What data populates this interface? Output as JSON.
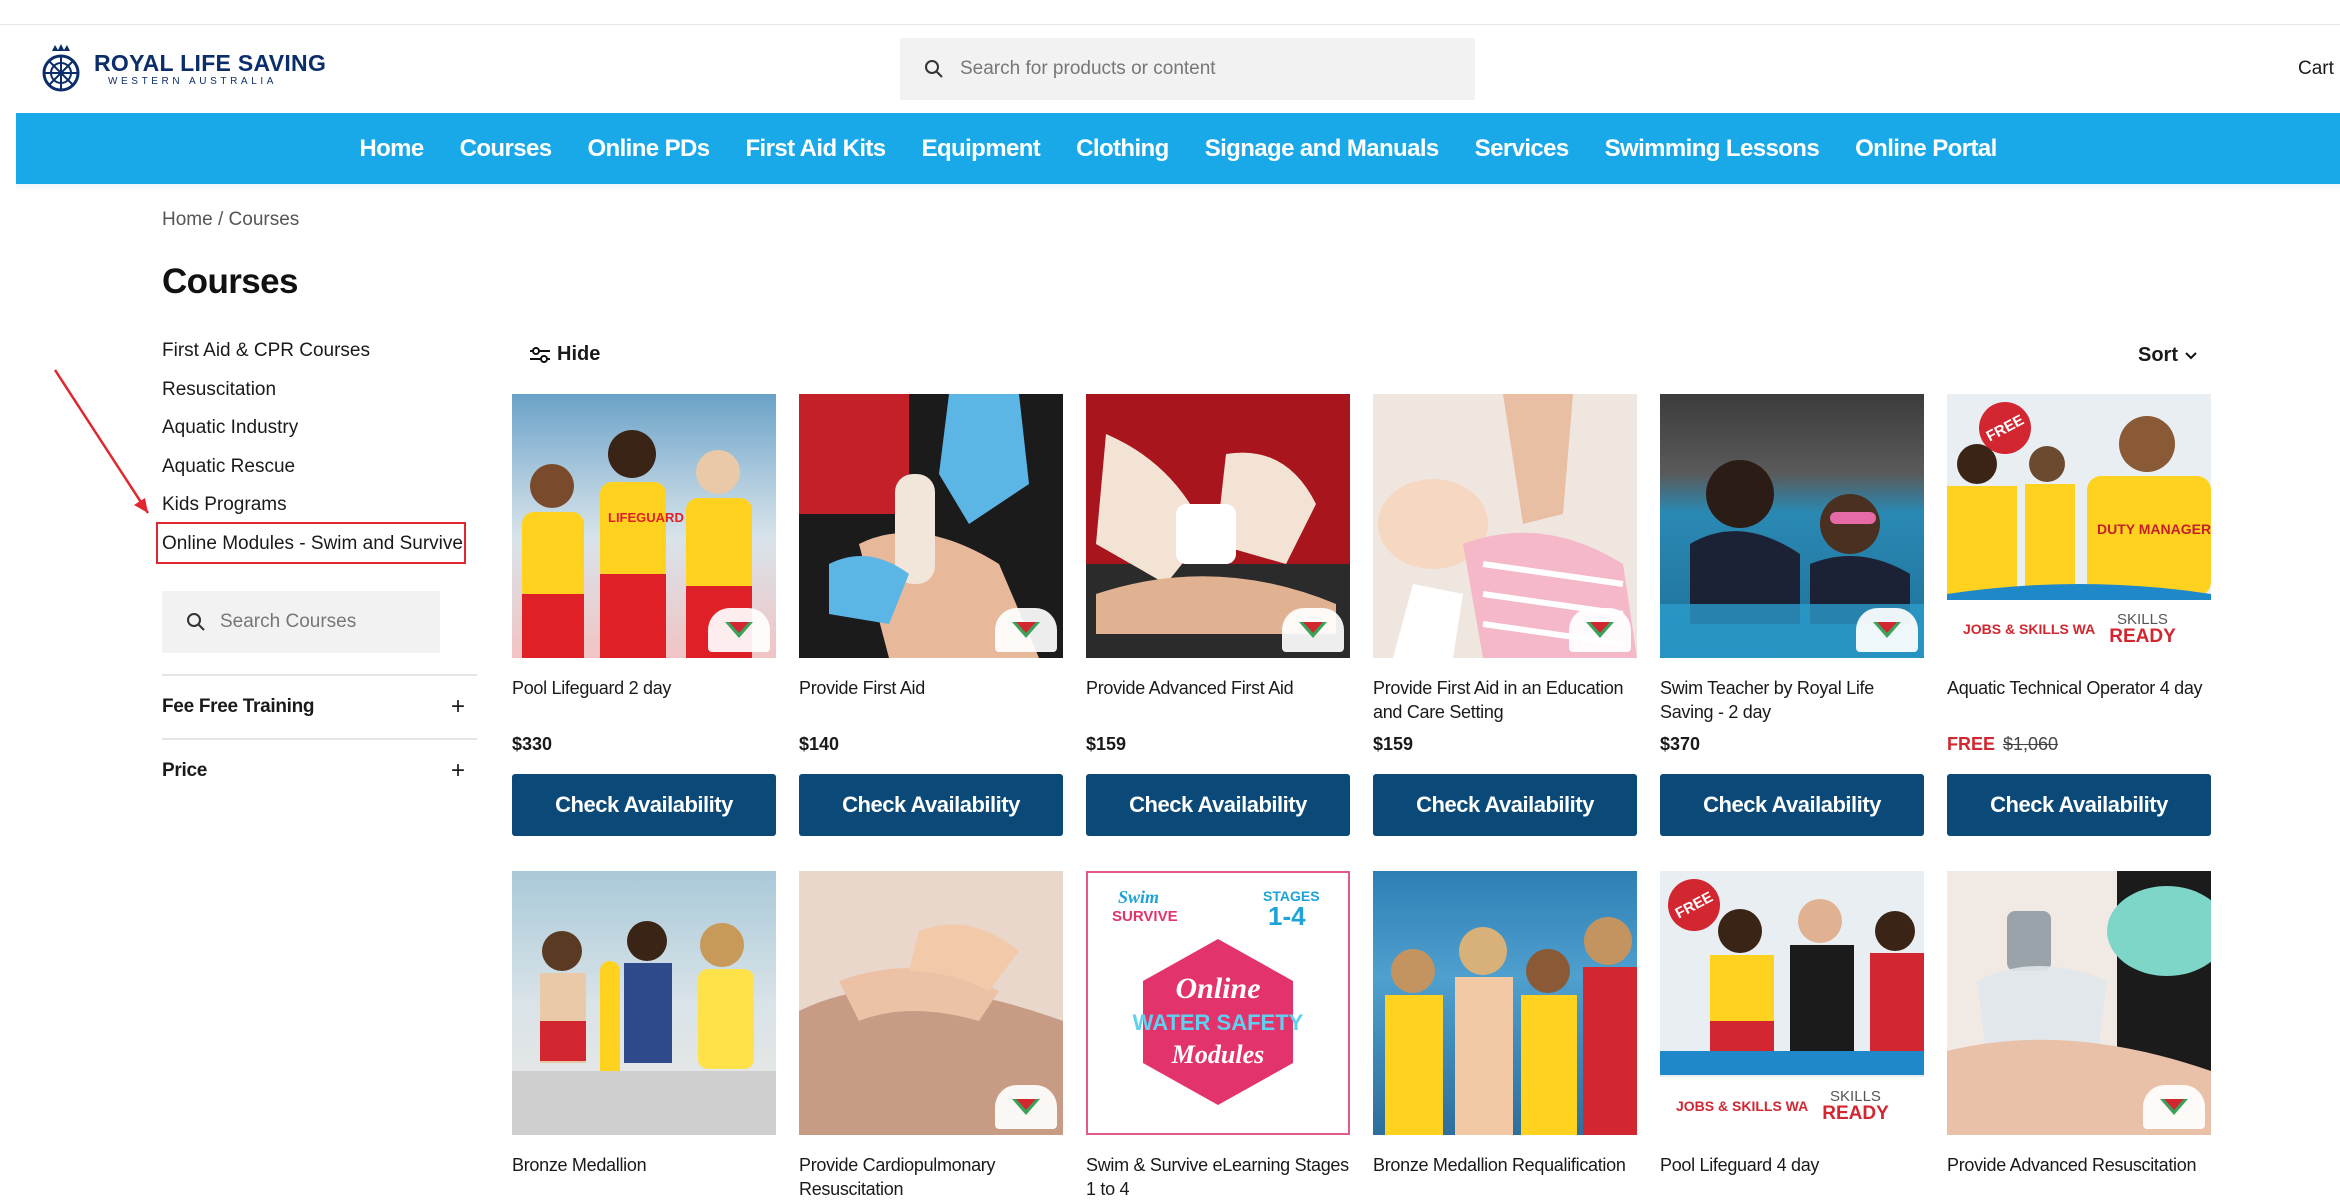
{
  "header": {
    "logo_title": "ROYAL LIFE SAVING",
    "logo_sub": "WESTERN AUSTRALIA",
    "search_placeholder": "Search for products or content",
    "cart": "Cart"
  },
  "nav": [
    "Home",
    "Courses",
    "Online PDs",
    "First Aid Kits",
    "Equipment",
    "Clothing",
    "Signage and Manuals",
    "Services",
    "Swimming Lessons",
    "Online Portal"
  ],
  "breadcrumb": {
    "home": "Home",
    "sep": "/",
    "current": "Courses"
  },
  "page_title": "Courses",
  "sidebar": {
    "categories": [
      "First Aid & CPR Courses",
      "Resuscitation",
      "Aquatic Industry",
      "Aquatic Rescue",
      "Kids Programs",
      "Online Modules - Swim and Survive"
    ],
    "search_placeholder": "Search Courses",
    "filters": [
      "Fee Free Training",
      "Price"
    ],
    "plus": "+"
  },
  "toolbar": {
    "hide": "Hide",
    "sort": "Sort"
  },
  "products": [
    {
      "name": "Pool Lifeguard 2 day",
      "price": "$330",
      "cta": "Check Availability"
    },
    {
      "name": "Provide First Aid",
      "price": "$140",
      "cta": "Check Availability"
    },
    {
      "name": "Provide Advanced First Aid",
      "price": "$159",
      "cta": "Check Availability"
    },
    {
      "name": "Provide First Aid in an Education and Care Setting",
      "price": "$159",
      "cta": "Check Availability"
    },
    {
      "name": "Swim Teacher by Royal Life Saving - 2 day",
      "price": "$370",
      "cta": "Check Availability"
    },
    {
      "name": "Aquatic Technical Operator 4 day",
      "price_label": "FREE",
      "price_old": "$1,060",
      "cta": "Check Availability",
      "badge": "FREE"
    },
    {
      "name": "Bronze Medallion"
    },
    {
      "name": "Provide Cardiopulmonary Resuscitation"
    },
    {
      "name": "Swim & Survive eLearning Stages 1 to 4"
    },
    {
      "name": "Bronze Medallion Requalification"
    },
    {
      "name": "Pool Lifeguard 4 day",
      "badge": "FREE"
    },
    {
      "name": "Provide Advanced Resuscitation"
    }
  ],
  "image_text": {
    "lifeguard": "LIFEGUARD",
    "duty_manager": "DUTY MANAGER",
    "jobs": "JOBS & SKILLS WA",
    "skills": "SKILLS",
    "ready": "READY",
    "swim": "Swim",
    "and_survive": "SURVIVE",
    "stages": "STAGES",
    "stages_num": "1-4",
    "online": "Online",
    "water_safety": "WATER SAFETY",
    "modules": "Modules"
  }
}
